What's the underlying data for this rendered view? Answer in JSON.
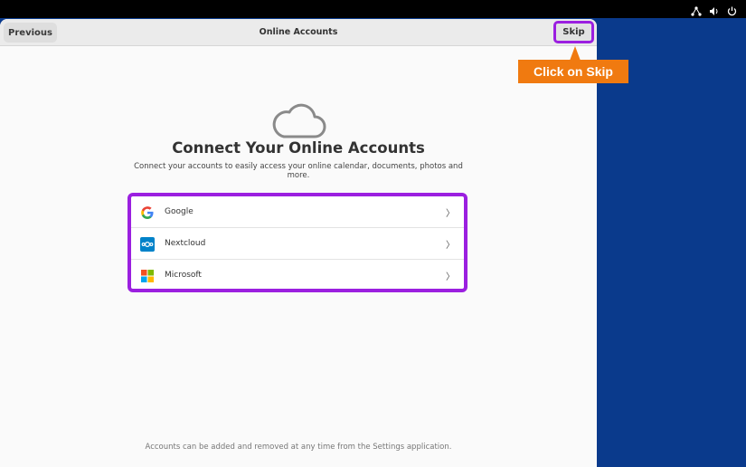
{
  "window": {
    "title": "Online Accounts",
    "previous_label": "Previous",
    "skip_label": "Skip"
  },
  "callout": {
    "text": "Click on Skip",
    "color": "#f07a10"
  },
  "main": {
    "heading": "Connect Your Online Accounts",
    "subtext": "Connect your accounts to easily access your online calendar, documents, photos and more.",
    "footer": "Accounts can be added and removed at any time from the Settings application."
  },
  "accounts": [
    {
      "label": "Google",
      "icon": "google-icon"
    },
    {
      "label": "Nextcloud",
      "icon": "nextcloud-icon"
    },
    {
      "label": "Microsoft",
      "icon": "microsoft-icon"
    }
  ],
  "tray": [
    "network-icon",
    "volume-icon",
    "power-icon"
  ],
  "colors": {
    "highlight": "#9b1fe0",
    "desktop": "#0a3a8c"
  }
}
